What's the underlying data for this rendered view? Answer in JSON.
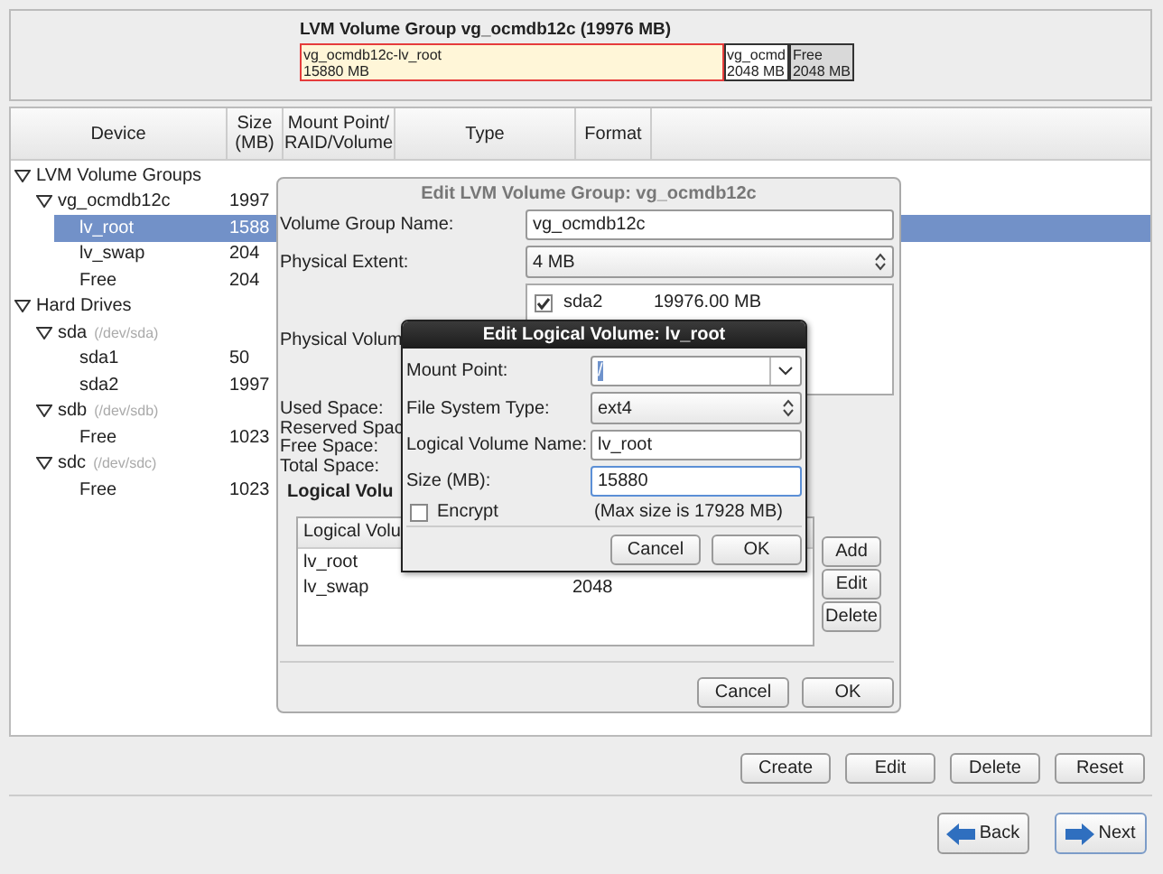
{
  "volume_group_bar": {
    "title": "LVM Volume Group vg_ocmdb12c (19976 MB)",
    "segments": [
      {
        "name": "vg_ocmdb12c-lv_root",
        "size": "15880 MB",
        "kind": "used",
        "selected": true
      },
      {
        "name": "vg_ocmd",
        "size": "2048 MB",
        "kind": "used",
        "selected": false
      },
      {
        "name": "Free",
        "size": "2048 MB",
        "kind": "free",
        "selected": false
      }
    ]
  },
  "device_table": {
    "columns": [
      "Device",
      "Size\n(MB)",
      "Mount Point/\nRAID/Volume",
      "Type",
      "Format"
    ],
    "tree": [
      {
        "label": "LVM Volume Groups",
        "expanded": true,
        "selected": false,
        "children": [
          {
            "label": "vg_ocmdb12c",
            "size": "1997",
            "expanded": true,
            "selected": false,
            "children": [
              {
                "label": "lv_root",
                "size": "1588",
                "selected": true
              },
              {
                "label": "lv_swap",
                "size": "204",
                "selected": false
              },
              {
                "label": "Free",
                "size": "204",
                "selected": false
              }
            ]
          }
        ]
      },
      {
        "label": "Hard Drives",
        "expanded": true,
        "selected": false,
        "children": [
          {
            "label": "sda",
            "hint": "(/dev/sda)",
            "expanded": true,
            "selected": false,
            "children": [
              {
                "label": "sda1",
                "size": "50",
                "selected": false
              },
              {
                "label": "sda2",
                "size": "1997",
                "selected": false
              }
            ]
          },
          {
            "label": "sdb",
            "hint": "(/dev/sdb)",
            "expanded": true,
            "selected": false,
            "children": [
              {
                "label": "Free",
                "size": "1023",
                "selected": false
              }
            ]
          },
          {
            "label": "sdc",
            "hint": "(/dev/sdc)",
            "expanded": true,
            "selected": false,
            "children": [
              {
                "label": "Free",
                "size": "1023",
                "selected": false
              }
            ]
          }
        ]
      }
    ]
  },
  "actions": [
    "Create",
    "Edit",
    "Delete",
    "Reset"
  ],
  "navigation": [
    {
      "label": "Back",
      "kind": "back",
      "focused": false
    },
    {
      "label": "Next",
      "kind": "next",
      "focused": true
    }
  ],
  "lvm_dialog": {
    "title": "Edit LVM Volume Group: vg_ocmdb12c",
    "fields": [
      {
        "label": "Volume Group Name:",
        "kind": "text",
        "value": "vg_ocmdb12c"
      },
      {
        "label": "Physical Extent:",
        "kind": "select",
        "value": "4 MB"
      }
    ],
    "physical_volumes": {
      "label": "Physical Volum",
      "items": [
        {
          "name": "sda2",
          "size": "19976.00 MB",
          "checked": true
        }
      ]
    },
    "space_labels": [
      "Used Space:",
      "Reserved Spac",
      "Free Space:",
      "Total Space:"
    ],
    "logical_volumes": {
      "heading": "Logical Volu",
      "column_1": "Logical Volu",
      "rows": [
        {
          "name": "lv_root"
        },
        {
          "name": "lv_swap",
          "size": "2048"
        }
      ]
    },
    "side_buttons": [
      "Add",
      "Edit",
      "Delete"
    ],
    "buttons": [
      "Cancel",
      "OK"
    ]
  },
  "lv_dialog": {
    "title": "Edit Logical Volume: lv_root",
    "fields": [
      {
        "label": "Mount Point:",
        "kind": "combo",
        "value": "/",
        "focused": false
      },
      {
        "label": "File System Type:",
        "kind": "select",
        "value": "ext4",
        "focused": false
      },
      {
        "label": "Logical Volume Name:",
        "kind": "text",
        "value": "lv_root",
        "focused": false
      },
      {
        "label": "Size (MB):",
        "kind": "text",
        "value": "15880",
        "focused": true
      }
    ],
    "encrypt": {
      "label": "Encrypt",
      "checked": false
    },
    "max_size": "(Max size is 17928 MB)",
    "buttons": [
      "Cancel",
      "OK"
    ]
  }
}
